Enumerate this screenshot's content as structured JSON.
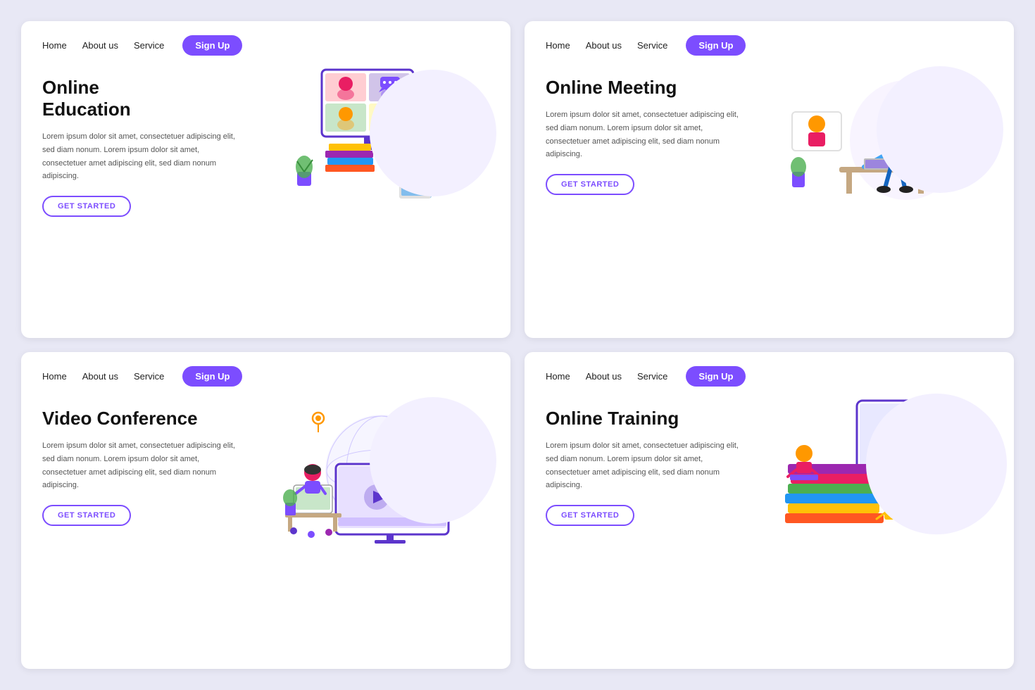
{
  "cards": [
    {
      "id": "online-education",
      "nav": {
        "home": "Home",
        "about": "About us",
        "service": "Service",
        "signup": "Sign Up"
      },
      "title": "Online\nEducation",
      "description": "Lorem ipsum dolor sit amet, consectetuer adipiscing elit, sed diam nonum. Lorem ipsum dolor sit amet, consectetuer amet adipiscing elit, sed diam nonum adipiscing.",
      "cta": "GET STARTED"
    },
    {
      "id": "online-meeting",
      "nav": {
        "home": "Home",
        "about": "About us",
        "service": "Service",
        "signup": "Sign Up"
      },
      "title": "Online Meeting",
      "description": "Lorem ipsum dolor sit amet, consectetuer adipiscing elit, sed diam nonum. Lorem ipsum dolor sit amet, consectetuer amet adipiscing elit, sed diam nonum adipiscing.",
      "cta": "GET STARTED"
    },
    {
      "id": "video-conference",
      "nav": {
        "home": "Home",
        "about": "About us",
        "service": "Service",
        "signup": "Sign Up"
      },
      "title": "Video Conference",
      "description": "Lorem ipsum dolor sit amet, consectetuer adipiscing elit, sed diam nonum. Lorem ipsum dolor sit amet, consectetuer amet adipiscing elit, sed diam nonum adipiscing.",
      "cta": "GET STARTED"
    },
    {
      "id": "online-training",
      "nav": {
        "home": "Home",
        "about": "About us",
        "service": "Service",
        "signup": "Sign Up"
      },
      "title": "Online Training",
      "description": "Lorem ipsum dolor sit amet, consectetuer adipiscing elit, sed diam nonum. Lorem ipsum dolor sit amet, consectetuer amet adipiscing elit, sed diam nonum adipiscing.",
      "cta": "GET STARTED"
    }
  ],
  "colors": {
    "purple": "#7c4dff",
    "darkPurple": "#5c35cc",
    "lightPurple": "#f0eeff",
    "bg": "#e8e8f5"
  }
}
